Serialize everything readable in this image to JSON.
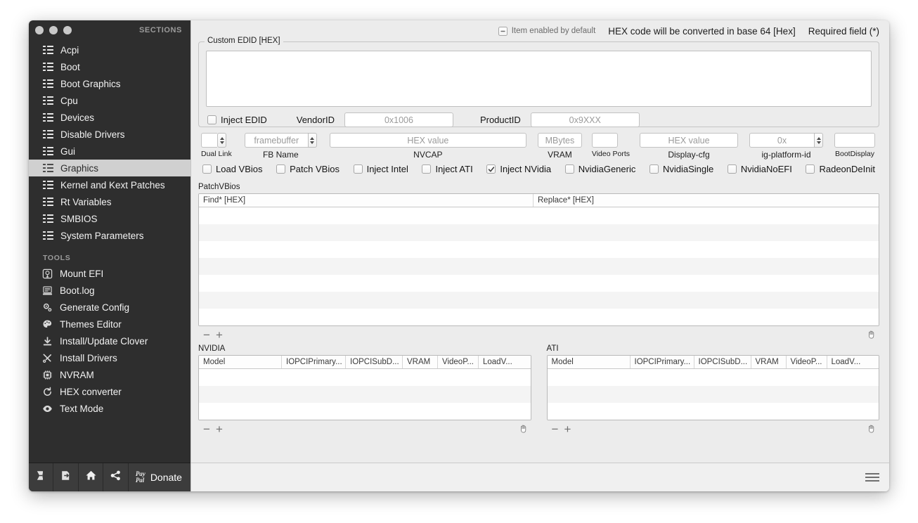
{
  "window": {
    "sections_label": "SECTIONS",
    "traffic_lights": [
      "close",
      "minimize",
      "zoom"
    ]
  },
  "sidebar": {
    "sections": [
      {
        "label": "Acpi",
        "icon": "list-icon",
        "selected": false
      },
      {
        "label": "Boot",
        "icon": "list-icon",
        "selected": false
      },
      {
        "label": "Boot Graphics",
        "icon": "list-icon",
        "selected": false
      },
      {
        "label": "Cpu",
        "icon": "list-icon",
        "selected": false
      },
      {
        "label": "Devices",
        "icon": "list-icon",
        "selected": false
      },
      {
        "label": "Disable Drivers",
        "icon": "list-icon",
        "selected": false
      },
      {
        "label": "Gui",
        "icon": "list-icon",
        "selected": false
      },
      {
        "label": "Graphics",
        "icon": "list-icon",
        "selected": true
      },
      {
        "label": "Kernel and Kext Patches",
        "icon": "list-icon",
        "selected": false
      },
      {
        "label": "Rt Variables",
        "icon": "list-icon",
        "selected": false
      },
      {
        "label": "SMBIOS",
        "icon": "list-icon",
        "selected": false
      },
      {
        "label": "System Parameters",
        "icon": "list-icon",
        "selected": false
      }
    ],
    "tools_label": "TOOLS",
    "tools": [
      {
        "label": "Mount EFI",
        "icon": "disk-icon"
      },
      {
        "label": "Boot.log",
        "icon": "log-icon"
      },
      {
        "label": "Generate Config",
        "icon": "gears-icon"
      },
      {
        "label": "Themes Editor",
        "icon": "palette-icon"
      },
      {
        "label": "Install/Update Clover",
        "icon": "download-icon"
      },
      {
        "label": "Install Drivers",
        "icon": "tools-icon"
      },
      {
        "label": "NVRAM",
        "icon": "chip-icon"
      },
      {
        "label": "HEX converter",
        "icon": "refresh-icon"
      },
      {
        "label": "Text Mode",
        "icon": "eye-icon"
      }
    ],
    "bottom_toolbar": {
      "buttons": [
        {
          "name": "import-icon"
        },
        {
          "name": "export-icon"
        },
        {
          "name": "home-icon"
        },
        {
          "name": "share-icon"
        }
      ],
      "paypal_line1": "Pay",
      "paypal_line2": "Pal",
      "donate_label": "Donate"
    }
  },
  "legend": {
    "enabled_by_default": "Item enabled by default",
    "hex_note": "HEX code will be converted in base 64 [Hex]",
    "required_note": "Required field (*)"
  },
  "edid": {
    "group_title": "Custom EDID [HEX]",
    "textarea_value": "",
    "inject_edid_label": "Inject EDID",
    "inject_edid_checked": false,
    "vendor_id_label": "VendorID",
    "vendor_id_placeholder": "0x1006",
    "vendor_id_value": "",
    "product_id_label": "ProductID",
    "product_id_placeholder": "0x9XXX",
    "product_id_value": ""
  },
  "graphics_fields": [
    {
      "name": "dual-link",
      "label": "Dual Link",
      "placeholder": "",
      "value": "",
      "control": "stepper-only"
    },
    {
      "name": "fb-name",
      "label": "FB Name",
      "placeholder": "framebuffer",
      "value": "",
      "control": "combo"
    },
    {
      "name": "nvcap",
      "label": "NVCAP",
      "placeholder": "HEX value",
      "value": "",
      "control": "field"
    },
    {
      "name": "vram",
      "label": "VRAM",
      "placeholder": "MBytes",
      "value": "",
      "control": "field"
    },
    {
      "name": "video-ports",
      "label": "Video Ports",
      "placeholder": "",
      "value": "",
      "control": "field"
    },
    {
      "name": "display-cfg",
      "label": "Display-cfg",
      "placeholder": "HEX value",
      "value": "",
      "control": "field"
    },
    {
      "name": "ig-platform-id",
      "label": "ig-platform-id",
      "placeholder": "0x",
      "value": "",
      "control": "combo"
    },
    {
      "name": "boot-display",
      "label": "BootDisplay",
      "placeholder": "",
      "value": "",
      "control": "field"
    }
  ],
  "checkboxes": [
    {
      "label": "Load VBios",
      "checked": false
    },
    {
      "label": "Patch VBios",
      "checked": false
    },
    {
      "label": "Inject Intel",
      "checked": false
    },
    {
      "label": "Inject ATI",
      "checked": false
    },
    {
      "label": "Inject NVidia",
      "checked": true
    },
    {
      "label": "NvidiaGeneric",
      "checked": false
    },
    {
      "label": "NvidiaSingle",
      "checked": false
    },
    {
      "label": "NvidiaNoEFI",
      "checked": false
    },
    {
      "label": "RadeonDeInit",
      "checked": false
    }
  ],
  "patch_vbios": {
    "group_title": "PatchVBios",
    "columns": [
      "Find* [HEX]",
      "Replace* [HEX]"
    ],
    "rows": [],
    "row_count": 7,
    "remove_label": "−",
    "add_label": "+",
    "grabber_icon": "hand-icon"
  },
  "nvidia_table": {
    "caption": "NVIDIA",
    "columns": [
      "Model",
      "IOPCIPrimary...",
      "IOPCISubD...",
      "VRAM",
      "VideoP...",
      "LoadV..."
    ],
    "rows": [],
    "row_count": 3,
    "remove_label": "−",
    "add_label": "+",
    "grabber_icon": "hand-icon"
  },
  "ati_table": {
    "caption": "ATI",
    "columns": [
      "Model",
      "IOPCIPrimary...",
      "IOPCISubD...",
      "VRAM",
      "VideoP...",
      "LoadV..."
    ],
    "rows": [],
    "row_count": 3,
    "remove_label": "−",
    "add_label": "+",
    "grabber_icon": "hand-icon"
  },
  "footer": {
    "menu_icon": "hamburger-icon"
  },
  "colors": {
    "sidebar_bg": "#2e2e2e",
    "selected_bg": "#d0d0d0",
    "panel_bg": "#ececec",
    "field_bg": "#ffffff",
    "text": "#151515"
  }
}
